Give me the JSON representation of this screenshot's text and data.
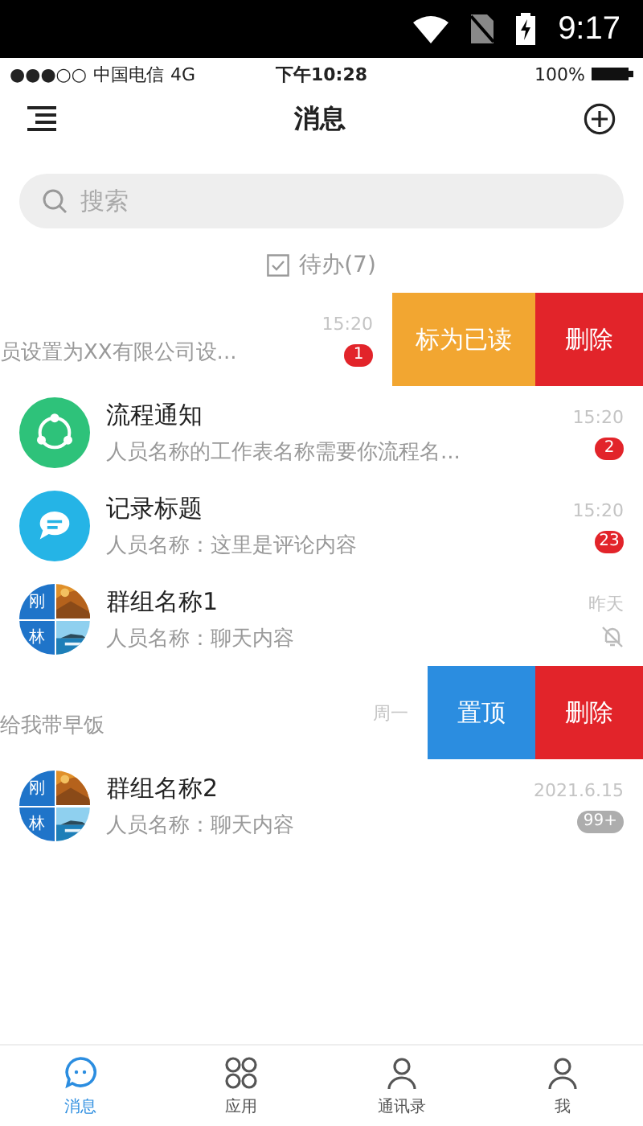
{
  "system_bar": {
    "time": "9:17"
  },
  "phone_status": {
    "signal": "●●●○○",
    "carrier": "中国电信",
    "network": "4G",
    "time": "下午10:28",
    "battery": "100%"
  },
  "header": {
    "title": "消息"
  },
  "search": {
    "placeholder": "搜索"
  },
  "todo": {
    "label": "待办(7)"
  },
  "conversations": [
    {
      "swiped": true,
      "preview": "员设置为XX有限公司设...",
      "time": "15:20",
      "badge": {
        "text": "1",
        "color": "#e2242a"
      },
      "actions": [
        {
          "label": "标为已读",
          "color": "#f2a631"
        },
        {
          "label": "删除",
          "color": "#e2242a"
        }
      ]
    },
    {
      "swiped": false,
      "avatar": {
        "kind": "sync",
        "color": "#2ec27a"
      },
      "title": "流程通知",
      "preview": "人员名称的工作表名称需要你流程名...",
      "time": "15:20",
      "badge": {
        "text": "2",
        "color": "#e2242a"
      }
    },
    {
      "swiped": false,
      "avatar": {
        "kind": "comment",
        "color": "#25b4e6"
      },
      "title": "记录标题",
      "preview": "人员名称：这里是评论内容",
      "time": "15:20",
      "badge": {
        "text": "23",
        "color": "#e2242a"
      }
    },
    {
      "swiped": false,
      "avatar": {
        "kind": "group",
        "names": [
          "刚",
          "林"
        ]
      },
      "title": "群组名称1",
      "preview": "人员名称：聊天内容",
      "time": "昨天",
      "muted": true
    },
    {
      "swiped": true,
      "preview": "给我带早饭",
      "time": "周一",
      "actions": [
        {
          "label": "置顶",
          "color": "#2b8de0"
        },
        {
          "label": "删除",
          "color": "#e2242a"
        }
      ]
    },
    {
      "swiped": false,
      "avatar": {
        "kind": "group",
        "names": [
          "刚",
          "林"
        ]
      },
      "title": "群组名称2",
      "preview": "人员名称：聊天内容",
      "time": "2021.6.15",
      "badge": {
        "text": "99+",
        "color": "#adadad"
      }
    }
  ],
  "tabs": [
    {
      "label": "消息",
      "kind": "chat",
      "selected": true
    },
    {
      "label": "应用",
      "kind": "apps",
      "selected": false
    },
    {
      "label": "通讯录",
      "kind": "contacts",
      "selected": false
    },
    {
      "label": "我",
      "kind": "me",
      "selected": false
    }
  ]
}
